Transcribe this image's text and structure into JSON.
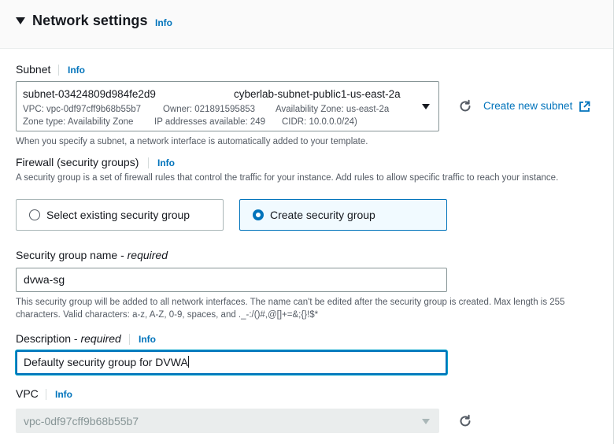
{
  "section": {
    "title": "Network settings",
    "info": "Info"
  },
  "subnet": {
    "label": "Subnet",
    "info": "Info",
    "id": "subnet-03424809d984fe2d9",
    "name": "cyberlab-subnet-public1-us-east-2a",
    "vpc": "VPC: vpc-0df97cff9b68b55b7",
    "owner": "Owner: 021891595853",
    "az": "Availability Zone: us-east-2a",
    "zone_type": "Zone type: Availability Zone",
    "ips": "IP addresses available: 249",
    "cidr": "CIDR: 10.0.0.0/24)",
    "create_link": "Create new subnet",
    "help": "When you specify a subnet, a network interface is automatically added to your template."
  },
  "firewall": {
    "label": "Firewall (security groups)",
    "info": "Info",
    "help": "A security group is a set of firewall rules that control the traffic for your instance. Add rules to allow specific traffic to reach your instance.",
    "options": [
      {
        "label": "Select existing security group",
        "selected": false
      },
      {
        "label": "Create security group",
        "selected": true
      }
    ]
  },
  "sg_name": {
    "label": "Security group name - ",
    "required": "required",
    "value": "dvwa-sg",
    "help": "This security group will be added to all network interfaces. The name can't be edited after the security group is created. Max length is 255 characters. Valid characters: a-z, A-Z, 0-9, spaces, and ._-:/()#,@[]+=&;{}!$*"
  },
  "description": {
    "label": "Description - ",
    "required": "required",
    "info": "Info",
    "value": "Defaulty security group for DVWA"
  },
  "vpc": {
    "label": "VPC",
    "info": "Info",
    "value": "vpc-0df97cff9b68b55b7"
  },
  "colors": {
    "accent": "#0073bb",
    "text": "#16191f",
    "muted": "#545b64"
  }
}
